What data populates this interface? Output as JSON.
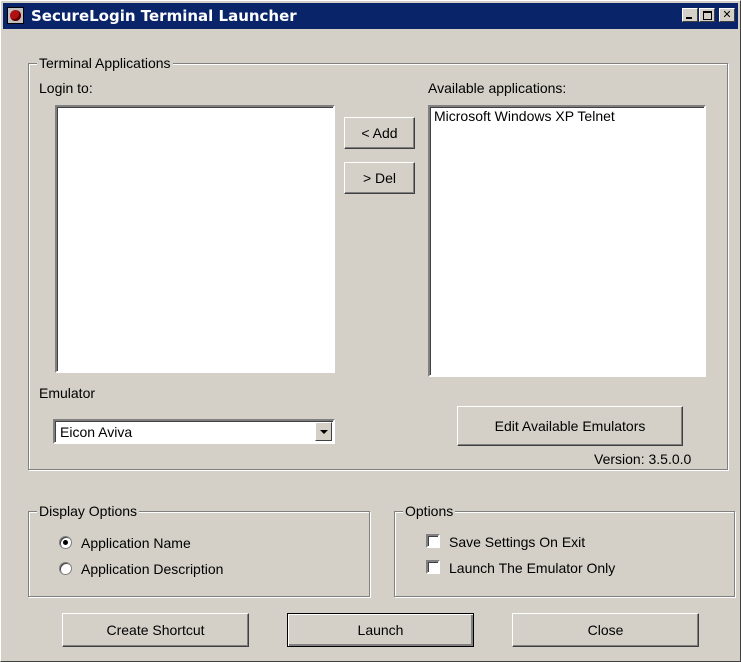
{
  "window": {
    "title": "SecureLogin Terminal Launcher",
    "controls": {
      "minimize": "_",
      "maximize": "□",
      "close": "✕"
    }
  },
  "terminal_group": {
    "legend": "Terminal Applications",
    "login_to_label": "Login to:",
    "login_to_items": [],
    "available_label": "Available applications:",
    "available_items": [
      "Microsoft Windows XP Telnet"
    ],
    "add_button": "< Add",
    "del_button": "> Del",
    "emulator_label": "Emulator",
    "emulator_value": "Eicon Aviva",
    "edit_emulators_button": "Edit Available Emulators",
    "version": "Version: 3.5.0.0"
  },
  "display_options": {
    "legend": "Display Options",
    "radios": [
      {
        "label": "Application Name",
        "checked": true
      },
      {
        "label": "Application Description",
        "checked": false
      }
    ]
  },
  "options": {
    "legend": "Options",
    "checkboxes": [
      {
        "label": "Save Settings On Exit",
        "checked": false
      },
      {
        "label": "Launch The Emulator Only",
        "checked": false
      }
    ]
  },
  "footer": {
    "create_shortcut": "Create Shortcut",
    "launch": "Launch",
    "close": "Close"
  },
  "icons": {
    "app": "securelogin-app-icon",
    "dropdown": "chevron-down-icon"
  }
}
